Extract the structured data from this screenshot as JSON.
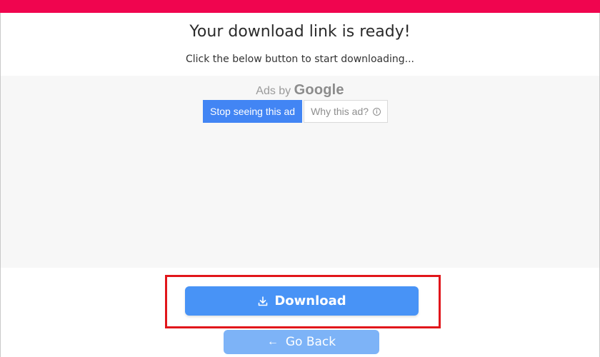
{
  "header": {
    "title": "Your download link is ready!",
    "subtitle": "Click the below button to start downloading..."
  },
  "ad": {
    "ads_by": "Ads by",
    "google": "Google",
    "stop_label": "Stop seeing this ad",
    "why_label": "Why this ad?",
    "info_glyph": "i"
  },
  "actions": {
    "download_label": "Download",
    "go_back_label": "Go Back",
    "go_back_arrow": "←"
  },
  "colors": {
    "top_bar": "#f0054f",
    "download_button": "#4893f6",
    "go_back_button": "#7db3f7",
    "stop_ad_button": "#4285f4",
    "highlight_box": "#e1161b"
  },
  "icons": {
    "download": "download-icon",
    "back": "arrow-left-icon",
    "info": "info-icon"
  }
}
